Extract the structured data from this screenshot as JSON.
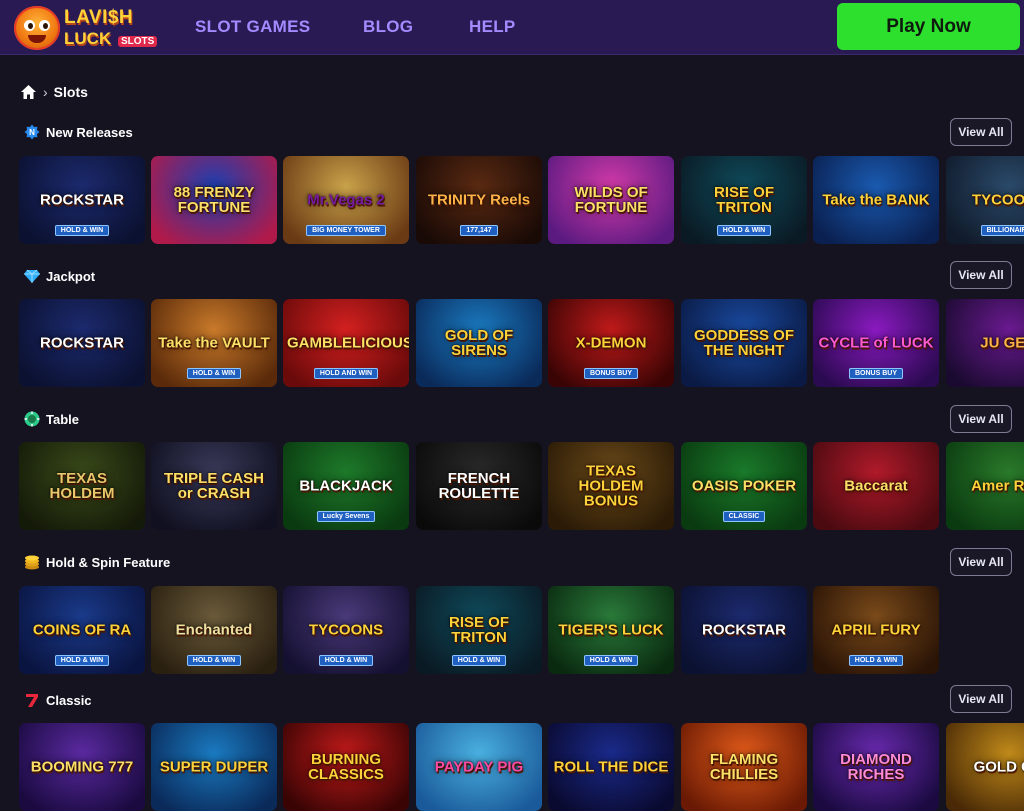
{
  "brand": {
    "line1": "LAVI$H",
    "line2": "LUCK",
    "tag": "SLOTS"
  },
  "nav": [
    {
      "label": "SLOT GAMES"
    },
    {
      "label": "BLOG"
    },
    {
      "label": "HELP"
    }
  ],
  "play_button": "Play Now",
  "breadcrumb": {
    "current": "Slots"
  },
  "view_all_label": "View All",
  "sections": [
    {
      "title": "New Releases",
      "icon": "new-badge-icon",
      "tiles": [
        {
          "title": "ROCKSTAR",
          "sub": "HOLD & WIN",
          "bg": "#1c2a6e",
          "bg2": "#0b1130",
          "fg": "#ffffff"
        },
        {
          "title": "88 FRENZY FORTUNE",
          "sub": "",
          "bg": "#1c3fb0",
          "bg2": "#b01a4a",
          "fg": "#ffe066"
        },
        {
          "title": "Mr.Vegas 2",
          "sub": "BIG MONEY TOWER",
          "bg": "#c9a24a",
          "bg2": "#6a3a14",
          "fg": "#7a1aa0"
        },
        {
          "title": "TRINITY Reels",
          "sub": "177,147",
          "bg": "#5a2a12",
          "bg2": "#1a0a06",
          "fg": "#ffb347"
        },
        {
          "title": "WILDS OF FORTUNE",
          "sub": "",
          "bg": "#d23aa8",
          "bg2": "#5a1a80",
          "fg": "#ffe066"
        },
        {
          "title": "RISE OF TRITON",
          "sub": "HOLD & WIN",
          "bg": "#0f4a5a",
          "bg2": "#0a1a24",
          "fg": "#ffd23a"
        },
        {
          "title": "Take the BANK",
          "sub": "",
          "bg": "#1a5ab0",
          "bg2": "#0a2050",
          "fg": "#ffd23a"
        },
        {
          "title": "TYCOONS",
          "sub": "BILLIONAIRE",
          "bg": "#2a4a6a",
          "bg2": "#101a2a",
          "fg": "#ffd23a"
        }
      ]
    },
    {
      "title": "Jackpot",
      "icon": "diamond-icon",
      "tiles": [
        {
          "title": "ROCKSTAR",
          "sub": "",
          "bg": "#1c2a6e",
          "bg2": "#0b1130",
          "fg": "#ffffff"
        },
        {
          "title": "Take the VAULT",
          "sub": "HOLD & WIN",
          "bg": "#c97a2a",
          "bg2": "#5a2a0a",
          "fg": "#ffe066"
        },
        {
          "title": "GAMBLELICIOUS",
          "sub": "HOLD AND WIN",
          "bg": "#d42020",
          "bg2": "#6a0a0a",
          "fg": "#ffe066"
        },
        {
          "title": "GOLD OF SIRENS",
          "sub": "",
          "bg": "#1a7ac0",
          "bg2": "#0a2a5a",
          "fg": "#ffd23a"
        },
        {
          "title": "X-DEMON",
          "sub": "BONUS BUY",
          "bg": "#c01a1a",
          "bg2": "#3a0404",
          "fg": "#ffd23a"
        },
        {
          "title": "GODDESS OF THE NIGHT",
          "sub": "",
          "bg": "#1a4aa0",
          "bg2": "#0a1a44",
          "fg": "#ffd23a"
        },
        {
          "title": "CYCLE of LUCK",
          "sub": "BONUS BUY",
          "bg": "#8a1ac0",
          "bg2": "#2a0a50",
          "fg": "#ff5ad0"
        },
        {
          "title": "JU GEM",
          "sub": "",
          "bg": "#6a1a90",
          "bg2": "#1a0a30",
          "fg": "#ffb347"
        }
      ]
    },
    {
      "title": "Table",
      "icon": "chip-icon",
      "tiles": [
        {
          "title": "TEXAS HOLDEM",
          "sub": "",
          "bg": "#3a4a1a",
          "bg2": "#141a08",
          "fg": "#e8c86a"
        },
        {
          "title": "TRIPLE CASH or CRASH",
          "sub": "",
          "bg": "#3a3a5a",
          "bg2": "#101020",
          "fg": "#ffe066"
        },
        {
          "title": "BLACKJACK",
          "sub": "Lucky Sevens",
          "bg": "#1e7a2a",
          "bg2": "#0a3a10",
          "fg": "#ffffff"
        },
        {
          "title": "FRENCH ROULETTE",
          "sub": "",
          "bg": "#2a2a2a",
          "bg2": "#0a0a0a",
          "fg": "#ffffff"
        },
        {
          "title": "TEXAS HOLDEM BONUS",
          "sub": "",
          "bg": "#6a4a1a",
          "bg2": "#2a1a06",
          "fg": "#ffd23a"
        },
        {
          "title": "OASIS POKER",
          "sub": "CLASSIC",
          "bg": "#1a7a2a",
          "bg2": "#0a3a10",
          "fg": "#ffe066"
        },
        {
          "title": "Baccarat",
          "sub": "",
          "bg": "#b01a2a",
          "bg2": "#4a0a10",
          "fg": "#ffe066"
        },
        {
          "title": "Amer Roul",
          "sub": "",
          "bg": "#2a7a2a",
          "bg2": "#0a3a10",
          "fg": "#ffd23a"
        }
      ]
    },
    {
      "title": "Hold & Spin Feature",
      "icon": "coins-icon",
      "tiles": [
        {
          "title": "COINS OF RA",
          "sub": "HOLD & WIN",
          "bg": "#1a3a8a",
          "bg2": "#0a1440",
          "fg": "#ffd23a"
        },
        {
          "title": "Enchanted",
          "sub": "HOLD & WIN",
          "bg": "#6a5a3a",
          "bg2": "#2a2010",
          "fg": "#f0e0a0"
        },
        {
          "title": "TYCOONS",
          "sub": "HOLD & WIN",
          "bg": "#4a3a7a",
          "bg2": "#141030",
          "fg": "#ffd23a"
        },
        {
          "title": "RISE OF TRITON",
          "sub": "HOLD & WIN",
          "bg": "#0f4a5a",
          "bg2": "#0a1a24",
          "fg": "#ffd23a"
        },
        {
          "title": "TIGER'S LUCK",
          "sub": "HOLD & WIN",
          "bg": "#2a7a3a",
          "bg2": "#0a2a10",
          "fg": "#ffd23a"
        },
        {
          "title": "ROCKSTAR",
          "sub": "",
          "bg": "#1c2a6e",
          "bg2": "#0b1130",
          "fg": "#ffffff"
        },
        {
          "title": "APRIL FURY",
          "sub": "HOLD & WIN",
          "bg": "#7a4a1a",
          "bg2": "#2a1406",
          "fg": "#ffd23a"
        }
      ]
    },
    {
      "title": "Classic",
      "icon": "seven-icon",
      "tiles": [
        {
          "title": "BOOMING 777",
          "sub": "",
          "bg": "#5a2aa0",
          "bg2": "#1a0a40",
          "fg": "#ffe066"
        },
        {
          "title": "SUPER DUPER",
          "sub": "",
          "bg": "#1a7ac0",
          "bg2": "#0a2a5a",
          "fg": "#ffd23a"
        },
        {
          "title": "BURNING CLASSICS",
          "sub": "",
          "bg": "#c01a1a",
          "bg2": "#3a0404",
          "fg": "#ffd23a"
        },
        {
          "title": "PAYDAY PIG",
          "sub": "",
          "bg": "#4ab0e0",
          "bg2": "#1a5a9a",
          "fg": "#ff4aa0"
        },
        {
          "title": "ROLL THE DICE",
          "sub": "",
          "bg": "#1a2a8a",
          "bg2": "#0a0a30",
          "fg": "#ffd23a"
        },
        {
          "title": "FLAMING CHILLIES",
          "sub": "",
          "bg": "#e05a1a",
          "bg2": "#6a1a04",
          "fg": "#ffe066"
        },
        {
          "title": "DIAMOND RICHES",
          "sub": "",
          "bg": "#6a2ab0",
          "bg2": "#1a0a40",
          "fg": "#ff8ad8"
        },
        {
          "title": "GOLD GO",
          "sub": "",
          "bg": "#c08a1a",
          "bg2": "#4a2a06",
          "fg": "#ffffff"
        }
      ]
    }
  ]
}
